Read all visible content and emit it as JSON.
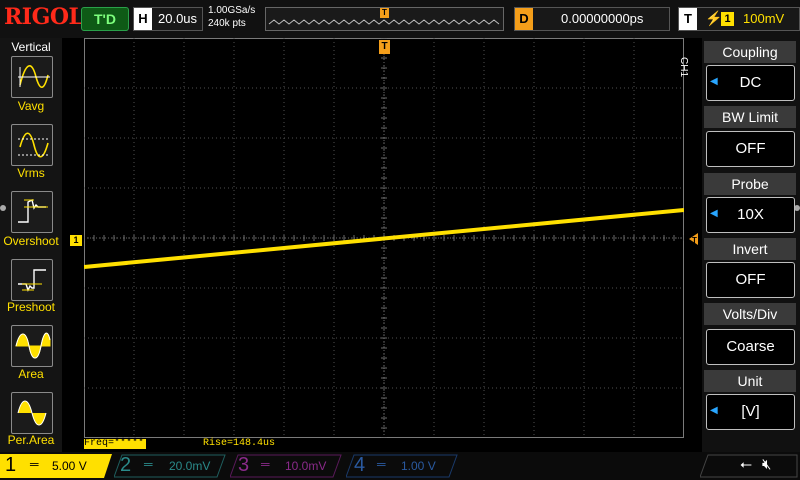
{
  "top": {
    "logo": "RIGOL",
    "run_status": "T'D",
    "horizontal_key": "H",
    "timebase": "20.0us",
    "sample_rate": "1.00GSa/s",
    "memory_depth": "240k pts",
    "delay_key": "D",
    "delay_value": "0.00000000ps",
    "trigger_key": "T",
    "trigger_source": "1",
    "trigger_level": "100mV",
    "trigger_marker": "T"
  },
  "left_panel": {
    "title": "Vertical",
    "items": [
      {
        "label": "Vavg",
        "icon": "vavg-icon"
      },
      {
        "label": "Vrms",
        "icon": "vrms-icon"
      },
      {
        "label": "Overshoot",
        "icon": "overshoot-icon"
      },
      {
        "label": "Preshoot",
        "icon": "preshoot-icon"
      },
      {
        "label": "Area",
        "icon": "area-icon"
      },
      {
        "label": "Per.Area",
        "icon": "per-area-icon"
      }
    ]
  },
  "screen": {
    "ch1_marker": "1",
    "trigger_level_marker": "T",
    "measurements": [
      "Freq=*****",
      "Rise=148.4us"
    ]
  },
  "right_menu": {
    "channel": "CH1",
    "items": [
      {
        "header": "Coupling",
        "value": "DC",
        "has_arrow": true
      },
      {
        "header": "BW Limit",
        "value": "OFF",
        "has_arrow": false
      },
      {
        "header": "Probe",
        "value": "10X",
        "has_arrow": true
      },
      {
        "header": "Invert",
        "value": "OFF",
        "has_arrow": false
      },
      {
        "header": "Volts/Div",
        "value": "Coarse",
        "has_arrow": false
      },
      {
        "header": "Unit",
        "value": "[V]",
        "has_arrow": true
      }
    ]
  },
  "bottom": {
    "channels": [
      {
        "num": "1",
        "scale": "5.00 V",
        "color": "#ffe000",
        "active": true
      },
      {
        "num": "2",
        "scale": "20.0mV",
        "color": "#2aa6a6",
        "active": false
      },
      {
        "num": "3",
        "scale": "10.0mV",
        "color": "#c02ac0",
        "active": false
      },
      {
        "num": "4",
        "scale": "1.00 V",
        "color": "#2a6ad0",
        "active": false
      }
    ]
  },
  "colors": {
    "ch1": "#ffe000",
    "trigger": "#f49e1a",
    "accent_blue": "#29a6ff",
    "grid": "#505050"
  }
}
